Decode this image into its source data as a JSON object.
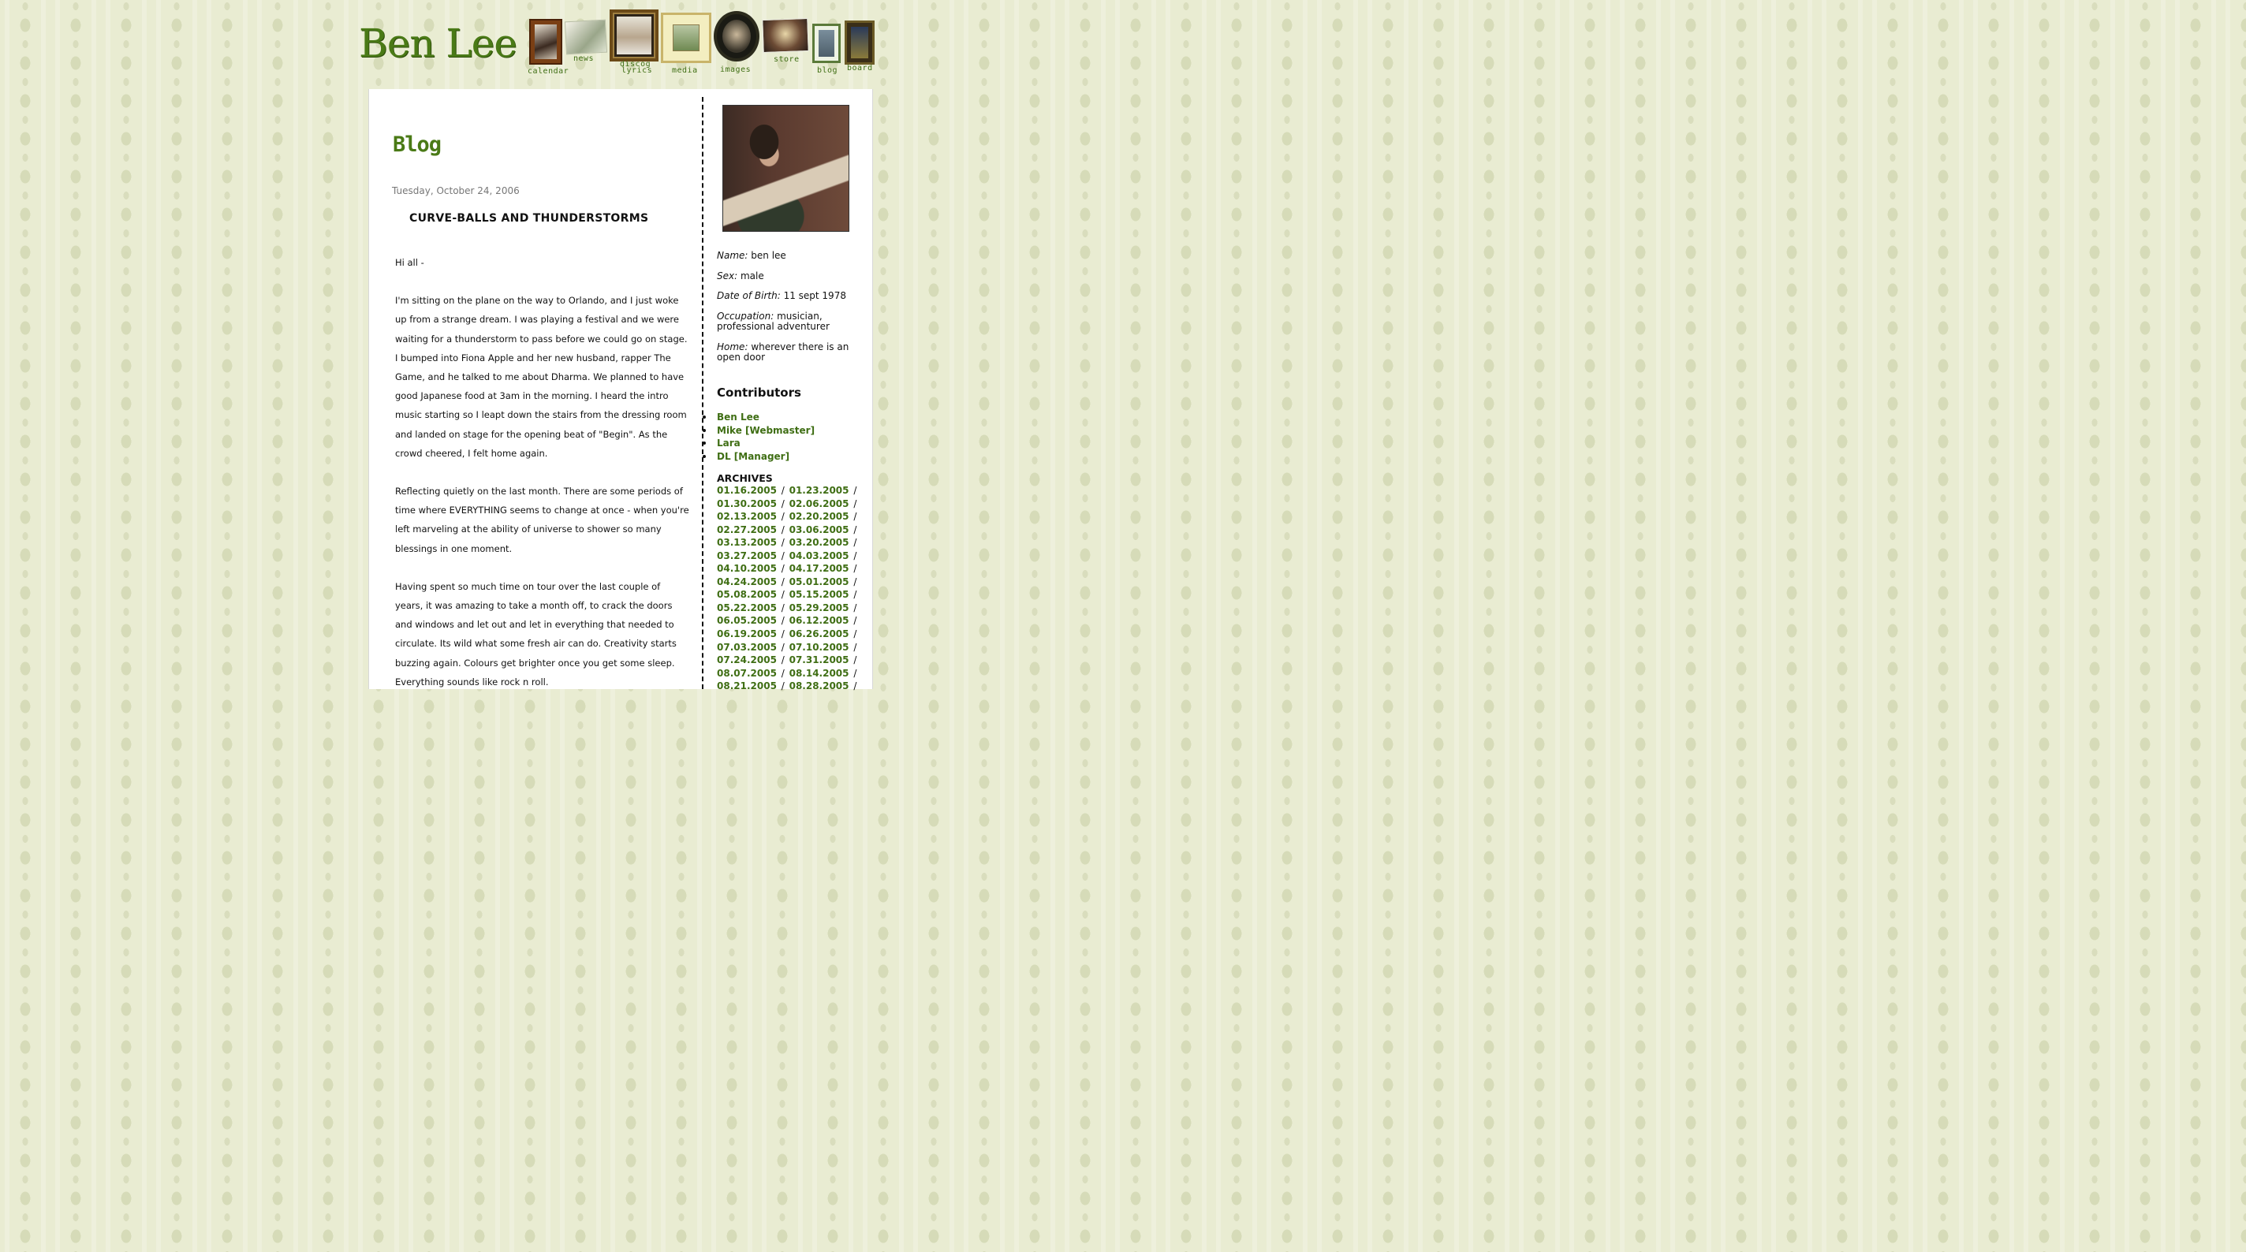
{
  "site": {
    "logo": "Ben Lee"
  },
  "nav": [
    {
      "label": "calendar"
    },
    {
      "label": "news"
    },
    {
      "label": "discog"
    },
    {
      "label": "lyrics"
    },
    {
      "label": "media"
    },
    {
      "label": "images"
    },
    {
      "label": "store"
    },
    {
      "label": "blog"
    },
    {
      "label": "board"
    }
  ],
  "blog": {
    "title": "Blog"
  },
  "post": {
    "date": "Tuesday, October 24, 2006",
    "title": "CURVE-BALLS AND THUNDERSTORMS",
    "paragraphs": [
      "Hi all -",
      "I'm sitting on the plane on the way to Orlando, and I just woke up from a strange dream. I was playing a festival and we were waiting for a thunderstorm to pass before we could go on stage. I bumped into Fiona Apple and her new husband, rapper The Game, and he talked to me about Dharma. We planned to have good Japanese food at 3am in the morning. I heard the intro music starting so I leapt down the stairs from the dressing room and landed on stage for the opening beat of \"Begin\". As the crowd cheered, I felt home again.",
      "Reflecting quietly on the last month. There are some periods of time where EVERYTHING seems to change at once - when you're left marveling at the ability of universe to shower so many blessings in one moment.",
      "Having spent so much time on tour over the last couple of years, it was amazing to take a month off, to crack the doors and windows and let out and let in everything that needed to circulate. Its wild what some fresh air can do. Creativity starts buzzing again. Colours get brighter once you get some sleep. Everything sounds like rock n roll."
    ]
  },
  "profile": {
    "name_label": "Name:",
    "name": "ben lee",
    "sex_label": "Sex:",
    "sex": "male",
    "dob_label": "Date of Birth:",
    "dob": "11 sept 1978",
    "occupation_label": "Occupation:",
    "occupation": "musician, professional adventurer",
    "home_label": "Home:",
    "home": "wherever there is an open door"
  },
  "contributors": {
    "heading": "Contributors",
    "items": [
      "Ben Lee",
      "Mike [Webmaster]",
      "Lara",
      "DL [Manager]"
    ]
  },
  "archives": {
    "heading": "ARCHIVES",
    "rows": [
      [
        "01.16.2005",
        "01.23.2005"
      ],
      [
        "01.30.2005",
        "02.06.2005"
      ],
      [
        "02.13.2005",
        "02.20.2005"
      ],
      [
        "02.27.2005",
        "03.06.2005"
      ],
      [
        "03.13.2005",
        "03.20.2005"
      ],
      [
        "03.27.2005",
        "04.03.2005"
      ],
      [
        "04.10.2005",
        "04.17.2005"
      ],
      [
        "04.24.2005",
        "05.01.2005"
      ],
      [
        "05.08.2005",
        "05.15.2005"
      ],
      [
        "05.22.2005",
        "05.29.2005"
      ],
      [
        "06.05.2005",
        "06.12.2005"
      ],
      [
        "06.19.2005",
        "06.26.2005"
      ],
      [
        "07.03.2005",
        "07.10.2005"
      ],
      [
        "07.24.2005",
        "07.31.2005"
      ],
      [
        "08.07.2005",
        "08.14.2005"
      ],
      [
        "08.21.2005",
        "08.28.2005"
      ]
    ]
  }
}
